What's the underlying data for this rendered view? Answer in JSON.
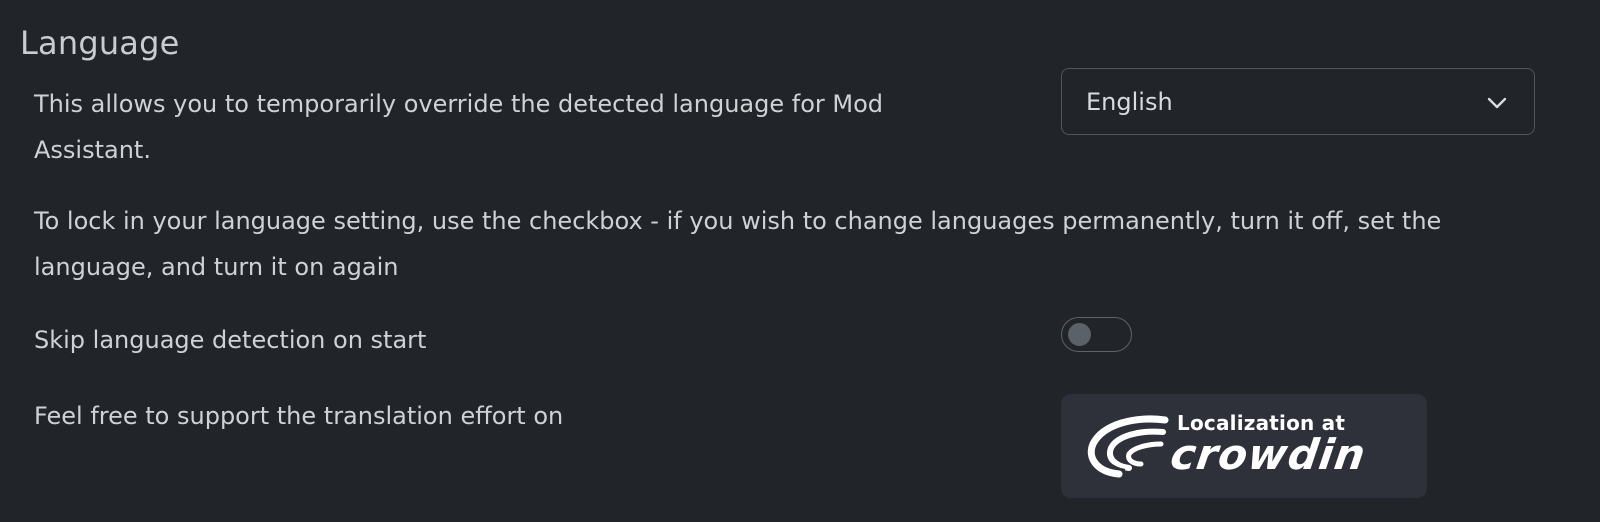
{
  "section": {
    "title": "Language"
  },
  "language_override": {
    "description": "This allows you to temporarily override the detected language for Mod Assistant.",
    "select": {
      "selected": "English",
      "icon": "chevron-down-icon"
    }
  },
  "lock_info": {
    "text": "To lock in your language setting, use the checkbox - if you wish to change languages permanently, turn it off, set the language, and turn it on again"
  },
  "skip_detection": {
    "label": "Skip language detection on start",
    "enabled": false
  },
  "translation_support": {
    "text": "Feel free to support the translation effort on",
    "badge": {
      "top_text": "Localization at",
      "brand": "crowdin",
      "icon": "crowdin-logo-icon"
    }
  },
  "colors": {
    "background": "#212429",
    "badge_background": "#2e3139",
    "border": "#50565d",
    "text": "#cfd2d5"
  }
}
